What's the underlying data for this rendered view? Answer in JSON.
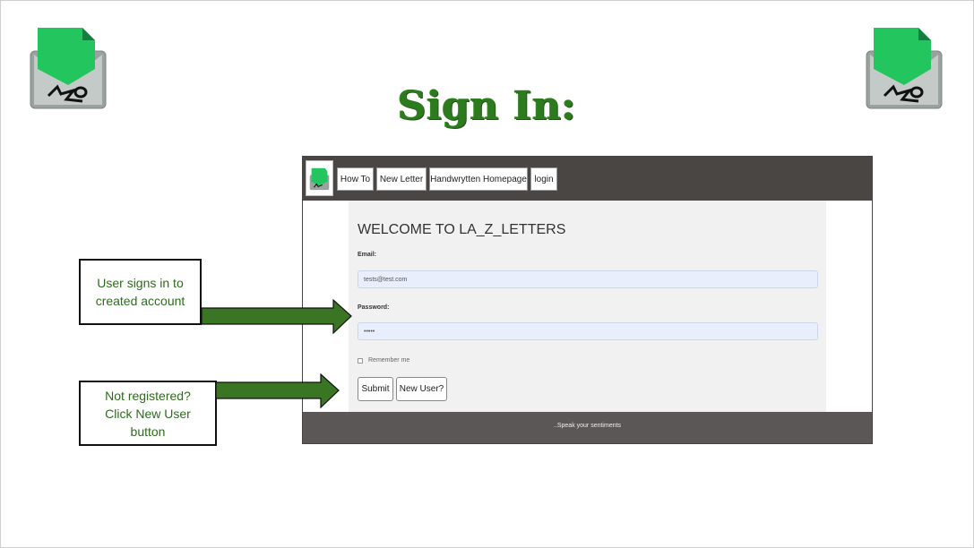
{
  "slide": {
    "title": "Sign In:"
  },
  "screenshot": {
    "nav": {
      "items": [
        "How To",
        "New Letter",
        "Handwrytten Homepage",
        "login"
      ]
    },
    "form": {
      "heading": "WELCOME TO LA_Z_LETTERS",
      "email_label": "Email:",
      "email_value": "tests@test.com",
      "password_label": "Password:",
      "password_value": "•••••",
      "remember_label": "Remember me",
      "submit_label": "Submit",
      "new_user_label": "New User?"
    },
    "footer": {
      "tagline": "..Speak your sentiments"
    }
  },
  "callouts": {
    "signin": "User signs in to created account",
    "register": "Not registered? Click New User button"
  },
  "colors": {
    "accent_green": "#2e7a1f",
    "arrow_green": "#3a7523",
    "nav_bg": "#4a4644",
    "logo_green": "#22c55e"
  }
}
